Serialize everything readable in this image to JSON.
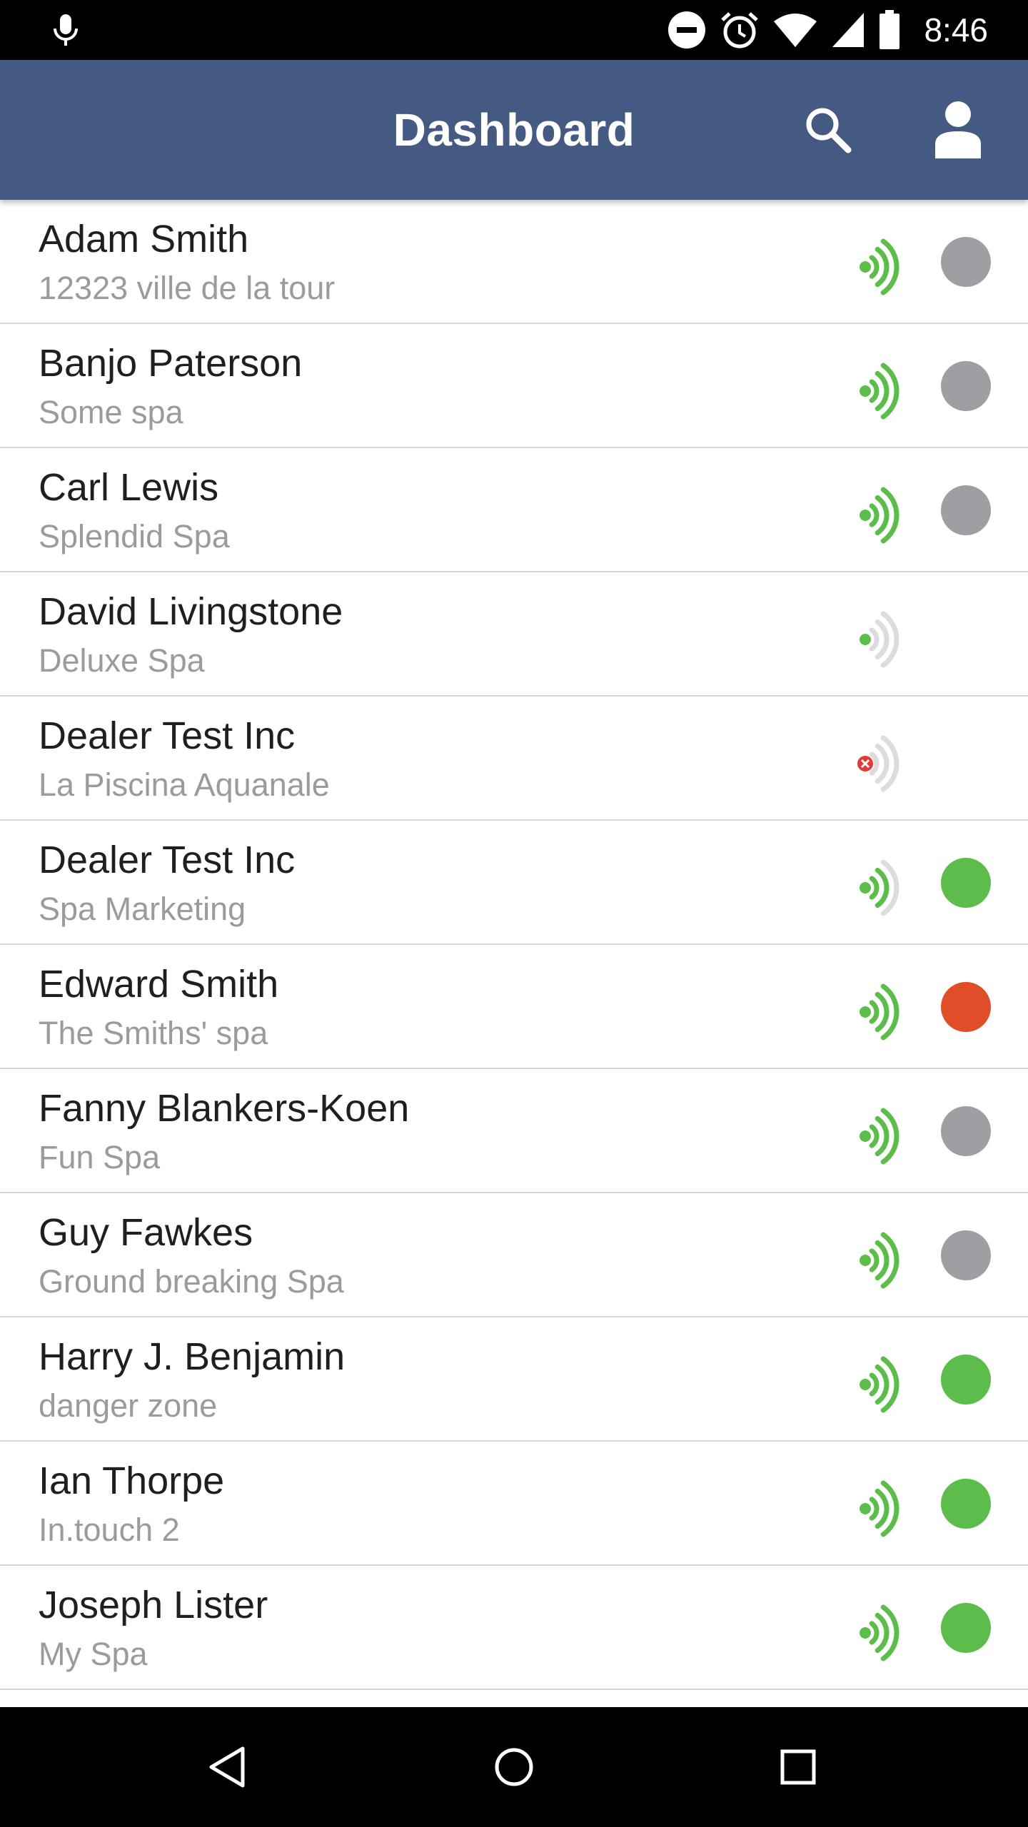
{
  "status_bar": {
    "time": "8:46",
    "icons": [
      "mic-icon",
      "do-not-disturb-icon",
      "alarm-icon",
      "wifi-icon",
      "cell-signal-icon",
      "battery-icon"
    ]
  },
  "header": {
    "title": "Dashboard",
    "search_icon": "search-icon",
    "profile_icon": "person-icon",
    "color": "#455a82"
  },
  "colors": {
    "signal_green": "#5cbd4a",
    "signal_faded": "#dcdcdc",
    "status_gray": "#9e9ea3",
    "status_green": "#5cbd4a",
    "status_red": "#e04e29",
    "error_red": "#e53935"
  },
  "devices": [
    {
      "name": "Adam Smith",
      "spa": "12323 ville de la tour",
      "signal": "full",
      "status": "gray"
    },
    {
      "name": "Banjo Paterson",
      "spa": "Some spa",
      "signal": "full",
      "status": "gray"
    },
    {
      "name": "Carl Lewis",
      "spa": "Splendid Spa",
      "signal": "full",
      "status": "gray"
    },
    {
      "name": "David Livingstone",
      "spa": "Deluxe Spa",
      "signal": "weak",
      "status": "none"
    },
    {
      "name": "Dealer Test Inc",
      "spa": "La Piscina Aquanale",
      "signal": "error",
      "status": "none"
    },
    {
      "name": "Dealer Test Inc",
      "spa": "Spa Marketing",
      "signal": "medium",
      "status": "green"
    },
    {
      "name": "Edward Smith",
      "spa": "The Smiths' spa",
      "signal": "full",
      "status": "red"
    },
    {
      "name": "Fanny Blankers-Koen",
      "spa": "Fun Spa",
      "signal": "full",
      "status": "gray"
    },
    {
      "name": "Guy Fawkes",
      "spa": "Ground breaking Spa",
      "signal": "full",
      "status": "gray"
    },
    {
      "name": "Harry J. Benjamin",
      "spa": "danger zone",
      "signal": "full",
      "status": "green"
    },
    {
      "name": "Ian Thorpe",
      "spa": "In.touch 2",
      "signal": "full",
      "status": "green"
    },
    {
      "name": "Joseph Lister",
      "spa": "My Spa",
      "signal": "full",
      "status": "green"
    }
  ],
  "nav_bar": {
    "icons": [
      "back-icon",
      "home-icon",
      "recents-icon"
    ]
  }
}
